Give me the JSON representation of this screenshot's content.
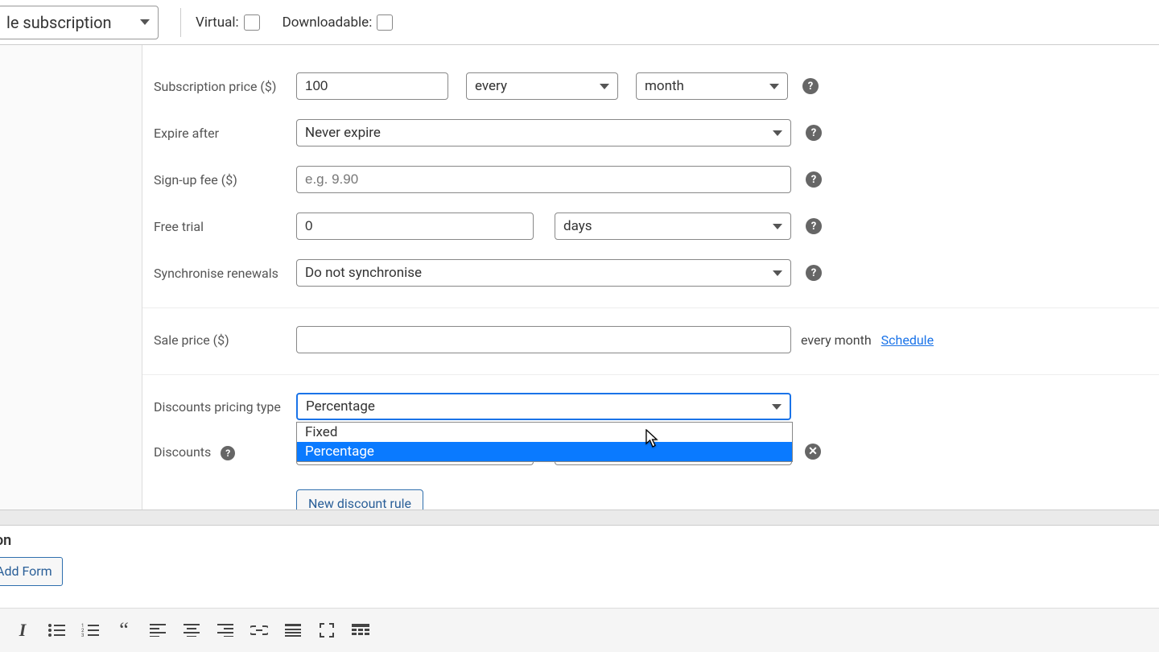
{
  "header": {
    "product_type": "le subscription",
    "virtual_label": "Virtual:",
    "downloadable_label": "Downloadable:"
  },
  "form": {
    "subscription_price": {
      "label": "Subscription price ($)",
      "value": "100",
      "interval": "every",
      "period": "month"
    },
    "expire_after": {
      "label": "Expire after",
      "value": "Never expire"
    },
    "signup_fee": {
      "label": "Sign-up fee ($)",
      "placeholder": "e.g. 9.90",
      "value": ""
    },
    "free_trial": {
      "label": "Free trial",
      "value": "0",
      "unit": "days"
    },
    "sync_renewals": {
      "label": "Synchronise renewals",
      "value": "Do not synchronise"
    },
    "sale_price": {
      "label": "Sale price ($)",
      "value": "",
      "suffix": "every month",
      "schedule": "Schedule"
    },
    "discounts_pricing_type": {
      "label": "Discounts pricing type",
      "value": "Percentage",
      "options": {
        "fixed": "Fixed",
        "percentage": "Percentage"
      }
    },
    "discounts": {
      "label": "Discounts"
    },
    "new_rule_label": "New discount rule"
  },
  "editor": {
    "section_title": "on",
    "add_form": "Add Form"
  }
}
